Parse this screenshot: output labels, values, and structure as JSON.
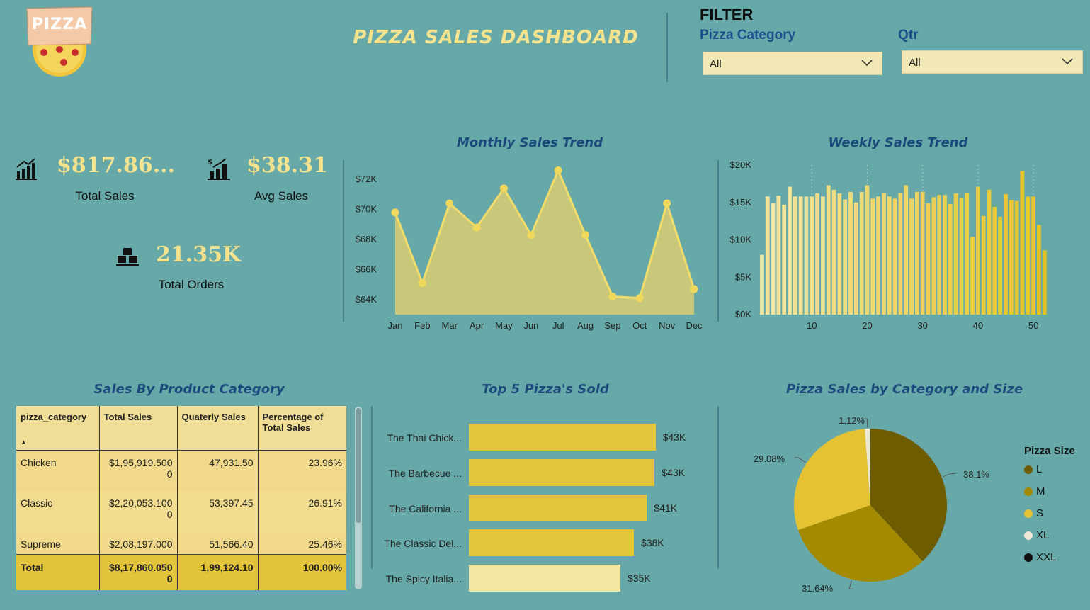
{
  "header": {
    "logo_text": "PIZZA",
    "title": "PIZZA SALES DASHBOARD"
  },
  "filter": {
    "title": "FILTER",
    "category": {
      "label": "Pizza Category",
      "value": "All"
    },
    "qtr": {
      "label": "Qtr",
      "value": "All"
    }
  },
  "kpis": {
    "total_sales": {
      "value": "$817.86...",
      "label": "Total Sales"
    },
    "avg_sales": {
      "value": "$38.31",
      "label": "Avg Sales"
    },
    "total_orders": {
      "value": "21.35K",
      "label": "Total Orders"
    }
  },
  "colors": {
    "background": "#67a9a9",
    "accent_yellow": "#f3e38f",
    "title_blue": "#1c4a7c",
    "bar_light": "#f2e6a4",
    "bar_dark": "#e5c31f"
  },
  "table": {
    "title": "Sales By Product Category",
    "headers": [
      "pizza_category",
      "Total Sales",
      "Quaterly Sales",
      "Percentage of Total Sales"
    ],
    "rows": [
      {
        "category": "Chicken",
        "total_sales": "$1,95,919.5000",
        "quarterly": "47,931.50",
        "pct": "23.96%"
      },
      {
        "category": "Classic",
        "total_sales": "$2,20,053.1000",
        "quarterly": "53,397.45",
        "pct": "26.91%"
      },
      {
        "category": "Supreme",
        "total_sales": "$2,08,197.000",
        "quarterly": "51,566.40",
        "pct": "25.46%"
      }
    ],
    "total": {
      "category": "Total",
      "total_sales": "$8,17,860.0500",
      "quarterly": "1,99,124.10",
      "pct": "100.00%"
    }
  },
  "chart_data": [
    {
      "type": "area",
      "title": "Monthly Sales Trend",
      "categories": [
        "Jan",
        "Feb",
        "Mar",
        "Apr",
        "May",
        "Jun",
        "Jul",
        "Aug",
        "Sep",
        "Oct",
        "Nov",
        "Dec"
      ],
      "values": [
        69800,
        65100,
        70400,
        68800,
        71400,
        68300,
        72600,
        68300,
        64200,
        64100,
        70400,
        64700
      ],
      "y_ticks": [
        "$64K",
        "$66K",
        "$68K",
        "$70K",
        "$72K"
      ],
      "ylim": [
        63000,
        73000
      ]
    },
    {
      "type": "bar",
      "title": "Weekly Sales Trend",
      "x": [
        1,
        2,
        3,
        4,
        5,
        6,
        7,
        8,
        9,
        10,
        11,
        12,
        13,
        14,
        15,
        16,
        17,
        18,
        19,
        20,
        21,
        22,
        23,
        24,
        25,
        26,
        27,
        28,
        29,
        30,
        31,
        32,
        33,
        34,
        35,
        36,
        37,
        38,
        39,
        40,
        41,
        42,
        43,
        44,
        45,
        46,
        47,
        48,
        49,
        50,
        51,
        52,
        53
      ],
      "values": [
        8000,
        15800,
        14900,
        15900,
        14700,
        17100,
        15800,
        15800,
        15800,
        15800,
        16200,
        15800,
        17300,
        16700,
        16200,
        15400,
        16400,
        15000,
        16400,
        17300,
        15500,
        15800,
        16300,
        15800,
        15500,
        16300,
        17300,
        15500,
        16400,
        16400,
        14900,
        15700,
        16000,
        16000,
        14800,
        16200,
        15600,
        16300,
        10400,
        17100,
        13200,
        16700,
        14400,
        13100,
        16100,
        15300,
        15200,
        19200,
        15800,
        15800,
        12000,
        8600,
        0
      ],
      "x_ticks": [
        "10",
        "20",
        "30",
        "40",
        "50"
      ],
      "y_ticks": [
        "$0K",
        "$5K",
        "$10K",
        "$15K",
        "$20K"
      ],
      "ylim": [
        0,
        20000
      ]
    },
    {
      "type": "bar",
      "orientation": "horizontal",
      "title": "Top 5 Pizza's Sold",
      "categories": [
        "The Thai Chick...",
        "The Barbecue ...",
        "The California ...",
        "The Classic Del...",
        "The Spicy Italia..."
      ],
      "values": [
        43000,
        42800,
        41000,
        38000,
        34900
      ],
      "value_labels": [
        "$43K",
        "$43K",
        "$41K",
        "$38K",
        "$35K"
      ]
    },
    {
      "type": "pie",
      "title": "Pizza Sales by Category and Size",
      "legend_title": "Pizza Size",
      "categories": [
        "L",
        "M",
        "S",
        "XL",
        "XXL"
      ],
      "values": [
        38.1,
        31.64,
        29.08,
        1.12,
        0.06
      ],
      "value_labels": [
        "38.1%",
        "31.64%",
        "29.08%",
        "1.12%",
        ""
      ],
      "colors": [
        "#6e5c00",
        "#a48a00",
        "#e4c232",
        "#efe9d2",
        "#111111"
      ]
    }
  ]
}
